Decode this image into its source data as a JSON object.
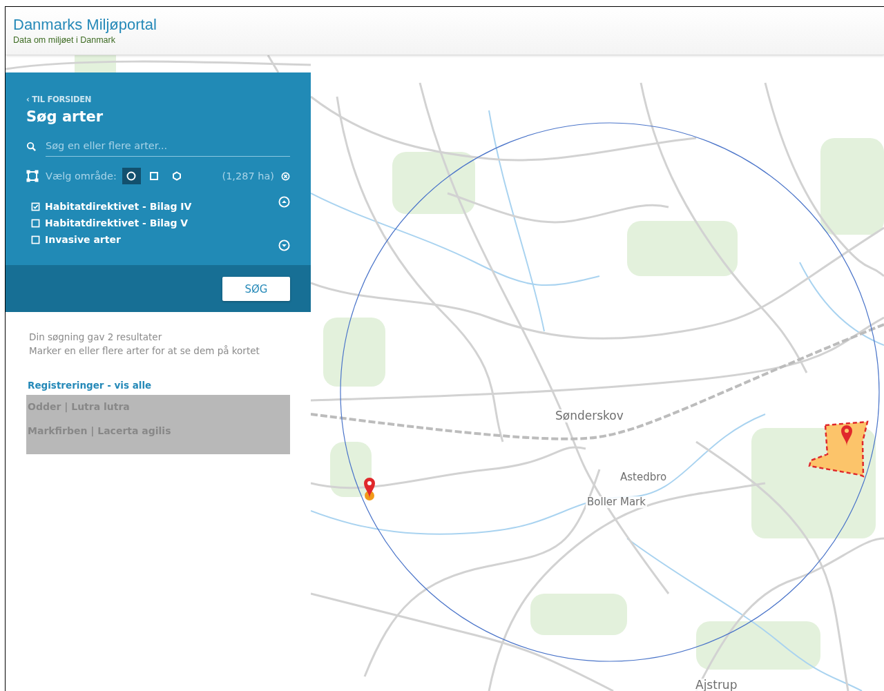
{
  "header": {
    "title": "Danmarks Miljøportal",
    "subtitle": "Data om miljøet i Danmark"
  },
  "search_panel": {
    "back_link": "‹ TIL FORSIDEN",
    "title": "Søg arter",
    "search": {
      "placeholder": "Søg en eller flere arter..."
    },
    "area": {
      "label": "Vælg område:",
      "area_size": "(1,287 ha)",
      "tools": [
        {
          "kind": "circle",
          "selected": true
        },
        {
          "kind": "square",
          "selected": false
        },
        {
          "kind": "polygon",
          "selected": false
        }
      ]
    },
    "filters": [
      {
        "label": "Habitatdirektivet - Bilag IV",
        "checked": true
      },
      {
        "label": "Habitatdirektivet - Bilag V",
        "checked": false
      },
      {
        "label": "Invasive arter",
        "checked": false
      }
    ],
    "button": "SØG"
  },
  "results": {
    "summary": "Din søgning gav 2 resultater",
    "hint": "Marker en eller flere arter for at se dem på kortet",
    "list_title": "Registreringer - vis alle",
    "rows": [
      {
        "label": "Odder | Lutra lutra"
      },
      {
        "label": "Markfirben | Lacerta agilis"
      }
    ]
  },
  "map": {
    "place_labels": [
      {
        "label": "Sønderskov",
        "kind": "town"
      },
      {
        "label": "Astedbro",
        "kind": "village"
      },
      {
        "label": "Boller Mark",
        "kind": "village"
      },
      {
        "label": "Ajstrup",
        "kind": "town"
      }
    ]
  }
}
